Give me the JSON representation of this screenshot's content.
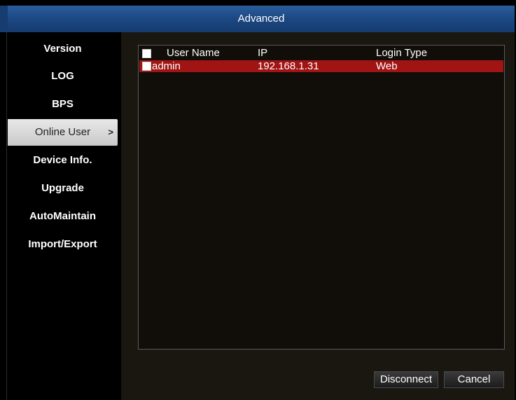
{
  "window": {
    "title": "Advanced"
  },
  "sidebar": {
    "items": [
      {
        "label": "Version"
      },
      {
        "label": "LOG"
      },
      {
        "label": "BPS"
      },
      {
        "label": "Online User"
      },
      {
        "label": "Device Info."
      },
      {
        "label": "Upgrade"
      },
      {
        "label": "AutoMaintain"
      },
      {
        "label": "Import/Export"
      }
    ],
    "active_index": 3,
    "active_chevron": ">"
  },
  "table": {
    "columns": [
      "User Name",
      "IP",
      "Login Type"
    ],
    "rows": [
      {
        "user_name": "admin",
        "ip": "192.168.1.31",
        "login_type": "Web",
        "selected": true
      }
    ]
  },
  "buttons": {
    "disconnect": "Disconnect",
    "cancel": "Cancel"
  },
  "colors": {
    "title_bar": "#1b4680",
    "selected_row": "#a01414",
    "active_sidebar": "#d9d9d9"
  }
}
